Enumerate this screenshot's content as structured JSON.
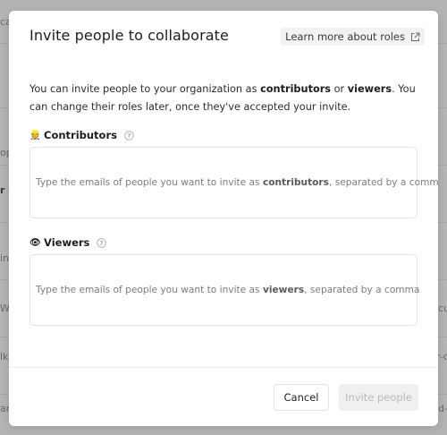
{
  "background": {
    "fragments": [
      "ca",
      "op",
      "r c",
      "in",
      "Wo",
      "lk",
      "ar",
      "cu",
      "r-c",
      "d-"
    ]
  },
  "modal": {
    "title": "Invite people to collaborate",
    "learn_more": {
      "label": "Learn more about roles",
      "icon": "external-link-icon"
    },
    "intro": {
      "part1": "You can invite people to your organization as ",
      "contributors": "contributors",
      "part2": " or ",
      "viewers": "viewers",
      "part3": ". You can change their roles later, once they've accepted your invite."
    },
    "contributors": {
      "emoji": "👷",
      "label": "Contributors",
      "help_icon": "help-circle-icon",
      "placeholder_prefix": "Type the emails of people you want to invite as ",
      "placeholder_role": "contributors",
      "placeholder_suffix": ", separated by a comma"
    },
    "viewers": {
      "emoji": "👁",
      "label": "Viewers",
      "help_icon": "help-circle-icon",
      "placeholder_prefix": "Type the emails of people you want to invite as ",
      "placeholder_role": "viewers",
      "placeholder_suffix": ", separated by a comma"
    },
    "footer": {
      "cancel_label": "Cancel",
      "invite_label": "Invite people",
      "invite_disabled": true
    }
  },
  "colors": {
    "overlay": "#9a9a9a",
    "modal_bg": "#ffffff",
    "border": "#e3e3e6",
    "disabled_button_bg": "#f0f0f2",
    "disabled_button_text": "#b9b9be"
  }
}
